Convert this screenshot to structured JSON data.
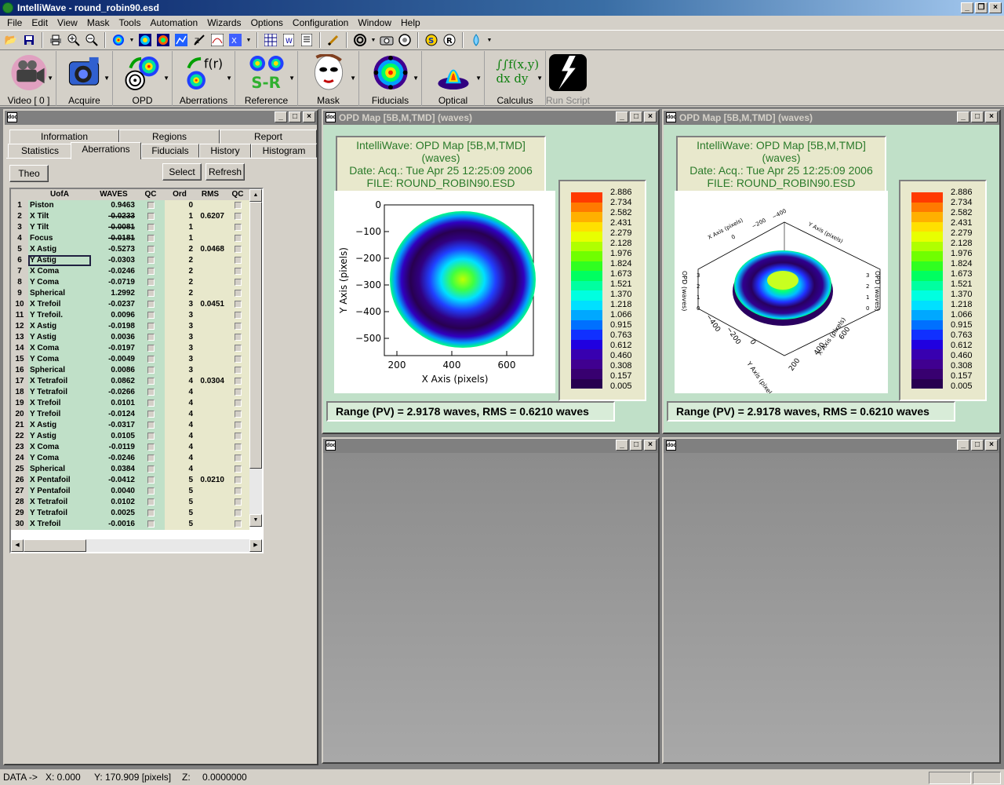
{
  "app": {
    "title": "IntelliWave - round_robin90.esd"
  },
  "menu": [
    "File",
    "Edit",
    "View",
    "Mask",
    "Tools",
    "Automation",
    "Wizards",
    "Options",
    "Configuration",
    "Window",
    "Help"
  ],
  "bigtools": [
    {
      "label": "Video [ 0 ]",
      "icon": "video-camera-icon"
    },
    {
      "label": "Acquire",
      "icon": "acquire-camera-icon"
    },
    {
      "label": "OPD",
      "icon": "opd-icon"
    },
    {
      "label": "Aberrations",
      "icon": "aberrations-icon"
    },
    {
      "label": "Reference",
      "icon": "reference-icon"
    },
    {
      "label": "Mask",
      "icon": "mask-icon"
    },
    {
      "label": "Fiducials",
      "icon": "fiducials-icon"
    },
    {
      "label": "Optical",
      "icon": "optical-icon"
    },
    {
      "label": "Calculus",
      "icon": "calculus-icon"
    },
    {
      "label": "Run Script",
      "icon": "run-script-icon"
    }
  ],
  "calc_glyph": "∫∫f(x,y)\ndx dy",
  "reference_glyph": "S-R",
  "fr_glyph": "f(r)",
  "left_panel": {
    "tabs_top": [
      "Information",
      "Regions",
      "Report"
    ],
    "tabs_bottom": [
      "Statistics",
      "Aberrations",
      "Fiducials",
      "History",
      "Histogram"
    ],
    "theo": "Theo",
    "select": "Select",
    "refresh": "Refresh",
    "headers": [
      "UofA",
      "WAVES",
      "QC",
      "Ord",
      "RMS",
      "QC"
    ],
    "rows": [
      [
        "1",
        "Piston",
        "0.9463",
        "0",
        ""
      ],
      [
        "2",
        "X Tilt",
        "-0.0233",
        "1",
        "0.6207"
      ],
      [
        "3",
        "Y Tilt",
        "-0.0081",
        "1",
        ""
      ],
      [
        "4",
        "Focus",
        "-0.0181",
        "1",
        ""
      ],
      [
        "5",
        "X Astig",
        "-0.5273",
        "2",
        "0.0468"
      ],
      [
        "6",
        "Y Astig",
        "-0.0303",
        "2",
        ""
      ],
      [
        "7",
        "X Coma",
        "-0.0246",
        "2",
        ""
      ],
      [
        "8",
        "Y Coma",
        "-0.0719",
        "2",
        ""
      ],
      [
        "9",
        "Spherical",
        "1.2992",
        "2",
        ""
      ],
      [
        "10",
        "X Trefoil",
        "-0.0237",
        "3",
        "0.0451"
      ],
      [
        "11",
        "Y Trefoil.",
        "0.0096",
        "3",
        ""
      ],
      [
        "12",
        "X Astig",
        "-0.0198",
        "3",
        ""
      ],
      [
        "13",
        "Y Astig",
        "0.0036",
        "3",
        ""
      ],
      [
        "14",
        "X Coma",
        "-0.0197",
        "3",
        ""
      ],
      [
        "15",
        "Y Coma",
        "-0.0049",
        "3",
        ""
      ],
      [
        "16",
        "Spherical",
        "0.0086",
        "3",
        ""
      ],
      [
        "17",
        "X Tetrafoil",
        "0.0862",
        "4",
        "0.0304"
      ],
      [
        "18",
        "Y Tetrafoil",
        "-0.0266",
        "4",
        ""
      ],
      [
        "19",
        "X Trefoil",
        "0.0101",
        "4",
        ""
      ],
      [
        "20",
        "Y Trefoil",
        "-0.0124",
        "4",
        ""
      ],
      [
        "21",
        "X Astig",
        "-0.0317",
        "4",
        ""
      ],
      [
        "22",
        "Y Astig",
        "0.0105",
        "4",
        ""
      ],
      [
        "23",
        "X Coma",
        "-0.0119",
        "4",
        ""
      ],
      [
        "24",
        "Y Coma",
        "-0.0246",
        "4",
        ""
      ],
      [
        "25",
        "Spherical",
        "0.0384",
        "4",
        ""
      ],
      [
        "26",
        "X Pentafoil",
        "-0.0412",
        "5",
        "0.0210"
      ],
      [
        "27",
        "Y Pentafoil",
        "0.0040",
        "5",
        ""
      ],
      [
        "28",
        "X Tetrafoil",
        "0.0102",
        "5",
        ""
      ],
      [
        "29",
        "Y Tetrafoil",
        "0.0025",
        "5",
        ""
      ],
      [
        "30",
        "X Trefoil",
        "-0.0016",
        "5",
        ""
      ]
    ]
  },
  "opd": {
    "win_title": "OPD Map [5B,M,TMD]  (waves)",
    "info": [
      "IntelliWave: OPD Map [5B,M,TMD]  (waves)",
      "Date: Acq.: Tue Apr 25 12:25:09 2006",
      "FILE: ROUND_ROBIN90.ESD"
    ],
    "range_text": "Range (PV) =   2.9178 waves, RMS =   0.6210 waves",
    "colorbar_labels": [
      "2.886",
      "2.734",
      "2.582",
      "2.431",
      "2.279",
      "2.128",
      "1.976",
      "1.824",
      "1.673",
      "1.521",
      "1.370",
      "1.218",
      "1.066",
      "0.915",
      "0.763",
      "0.612",
      "0.460",
      "0.308",
      "0.157",
      "0.005"
    ],
    "colorbar_colors": [
      "#ff3a00",
      "#ff7a00",
      "#ffb000",
      "#ffe000",
      "#e8ff00",
      "#b0ff00",
      "#70ff00",
      "#30ff20",
      "#00ff60",
      "#00ffa0",
      "#00ffe0",
      "#00e0ff",
      "#00a8ff",
      "#0070ff",
      "#1030ff",
      "#2000e0",
      "#3800b0",
      "#400090",
      "#380070",
      "#280050"
    ]
  },
  "chart_data": [
    {
      "type": "heatmap",
      "xlabel": "X Axis   (pixels)",
      "ylabel": "Y Axis   (pixels)",
      "xticks": [
        "200",
        "400",
        "600"
      ],
      "yticks": [
        "0",
        "−100",
        "−200",
        "−300",
        "−400",
        "−500"
      ]
    },
    {
      "type": "heatmap",
      "xlabel": "X Axis   (pixels)",
      "ylabel": "Y Axis   (pixels)",
      "zlabel": "OPD (waves)",
      "xticks": [
        "200",
        "400",
        "600"
      ],
      "yticks": [
        "−400",
        "−200",
        "0"
      ],
      "ztick_labels": [
        "3",
        "2",
        "1",
        "0"
      ]
    }
  ],
  "status": {
    "data": "DATA ->",
    "x": "X:  0.000",
    "y": "Y:  170.909  [pixels]",
    "z": "Z:",
    "zval": "0.0000000"
  }
}
